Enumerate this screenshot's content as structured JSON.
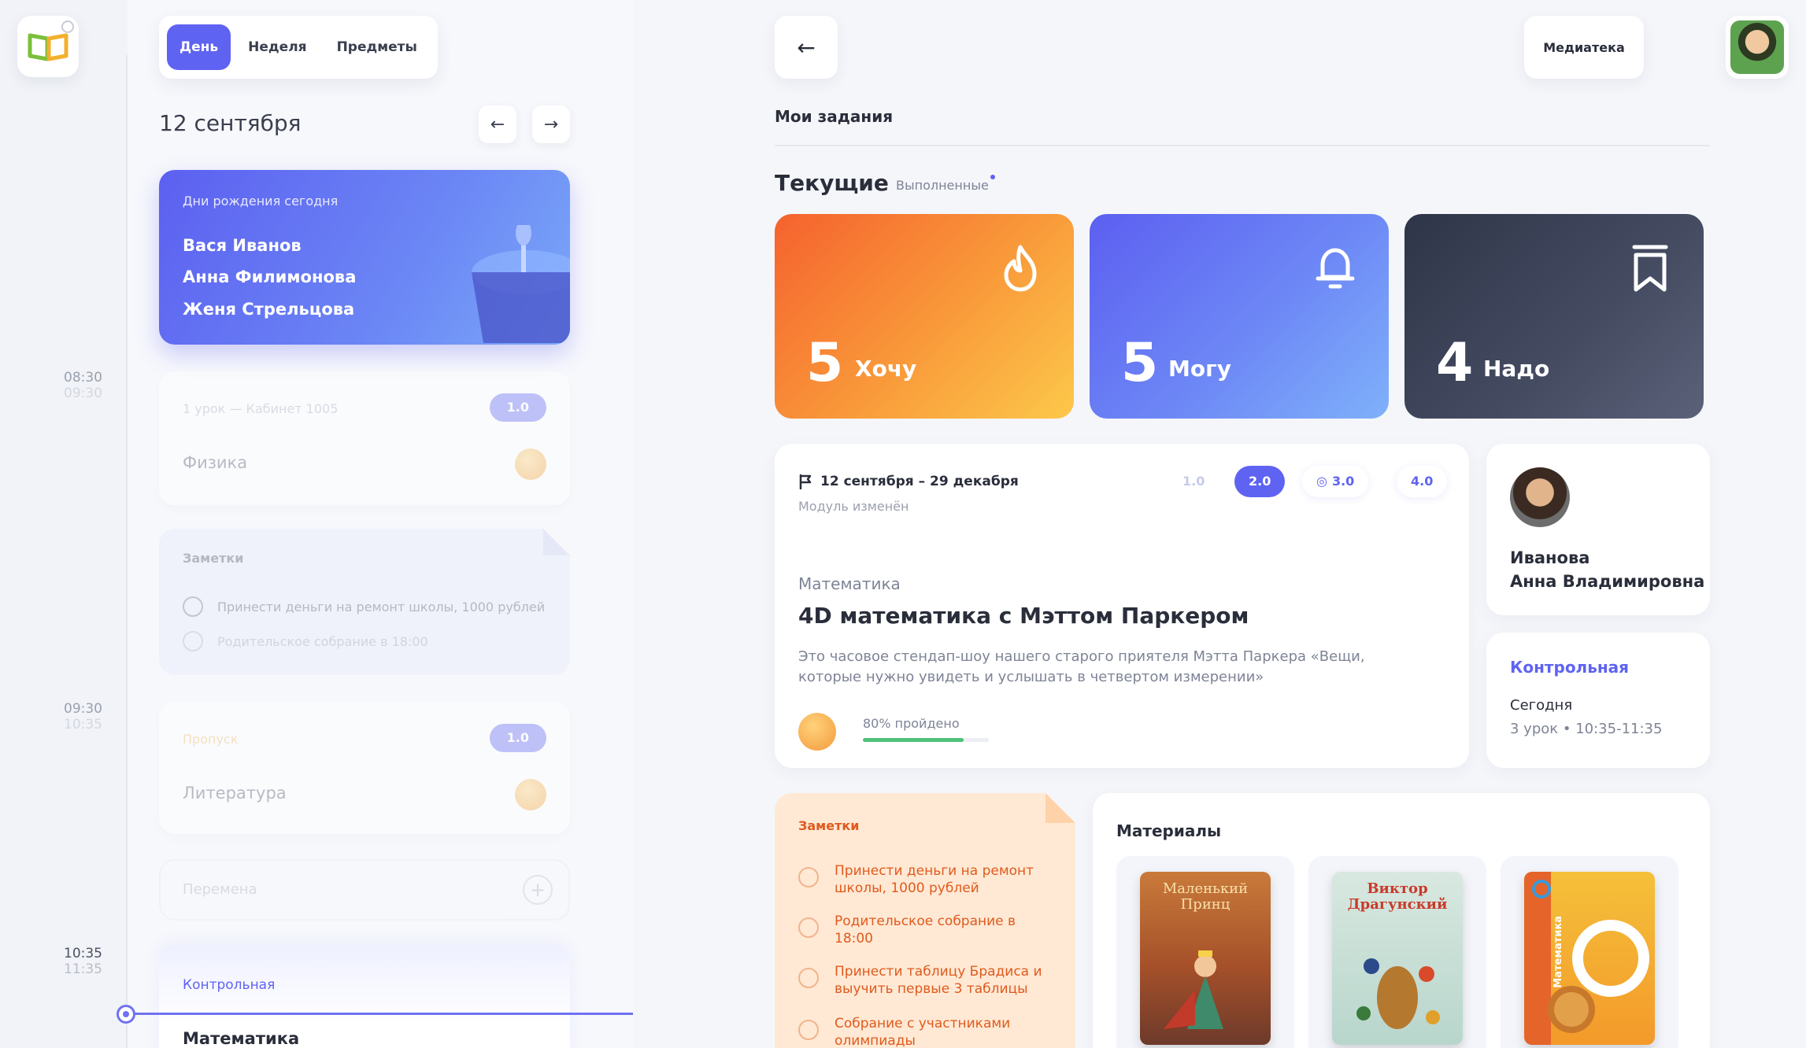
{
  "segments": {
    "day": "День",
    "week": "Неделя",
    "subjects": "Предметы"
  },
  "schedule": {
    "date": "12 сентября",
    "birthdays": {
      "label": "Дни рождения сегодня",
      "names": [
        "Вася Иванов",
        "Анна Филимонова",
        "Женя Стрельцова"
      ]
    },
    "lesson1": {
      "meta": "1 урок  —  Кабинет 1005",
      "version": "1.0",
      "subject": "Физика"
    },
    "notes": {
      "title": "Заметки",
      "items": [
        "Принести деньги на ремонт школы, 1000 рублей",
        "Родительское собрание в 18:00"
      ]
    },
    "lesson2": {
      "meta": "Пропуск",
      "version": "1.0",
      "subject": "Литература"
    },
    "break": {
      "label": "Перемена"
    },
    "control": {
      "label": "Контрольная",
      "subject": "Математика"
    }
  },
  "times": [
    {
      "start": "08:30",
      "end": "09:30"
    },
    {
      "start": "09:30",
      "end": "10:35"
    },
    {
      "start": "10:35",
      "end": "11:35"
    }
  ],
  "header": {
    "media_label": "Медиатека",
    "section_title": "Мои задания"
  },
  "tabs": {
    "current": "Текущие",
    "done": "Выполненные"
  },
  "stats": [
    {
      "count": "5",
      "label": "Хочу",
      "icon": "flame-icon"
    },
    {
      "count": "5",
      "label": "Могу",
      "icon": "bell-icon"
    },
    {
      "count": "4",
      "label": "Надо",
      "icon": "bookmark-icon"
    }
  ],
  "course": {
    "dates": "12 сентября – 29 декабря",
    "changed": "Модуль изменён",
    "versions": [
      "1.0",
      "2.0",
      "3.0",
      "4.0"
    ],
    "subject": "Математика",
    "title": "4D математика с Мэттом Паркером",
    "description": "Это часовое стендап-шоу нашего старого приятеля Мэтта Паркера «Вещи, которые нужно увидеть и услышать в четвертом измерении»",
    "progress_label": "80% пройдено",
    "progress": 0.8
  },
  "teacher": {
    "name_line1": "Иванова",
    "name_line2": "Анна Владимировна"
  },
  "test": {
    "label": "Контрольная",
    "day": "Сегодня",
    "time": "3 урок  •  10:35-11:35"
  },
  "main_notes": {
    "title": "Заметки",
    "items": [
      "Принести деньги на ремонт школы, 1000 рублей",
      "Родительское собрание в 18:00",
      "Принести таблицу Брадиса и выучить первые 3 таблицы",
      "Собрание с участниками олимпиады"
    ]
  },
  "materials": {
    "title": "Материалы",
    "books": [
      {
        "title": "Маленький Принц"
      },
      {
        "title": "Виктор Драгунский"
      },
      {
        "title": "Математика"
      }
    ]
  }
}
